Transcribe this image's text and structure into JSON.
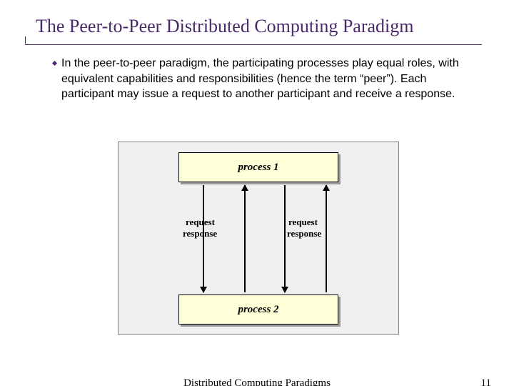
{
  "title": "The Peer-to-Peer Distributed Computing Paradigm",
  "body_text": "In the peer-to-peer paradigm, the participating processes play equal roles, with equivalent capabilities and responsibilities (hence the term “peer”).  Each participant may issue a request to another participant and receive a response.",
  "diagram": {
    "process1": "process 1",
    "process2": "process 2",
    "request": "request",
    "response": "response"
  },
  "footer": {
    "center": "Distributed Computing Paradigms",
    "page": "11"
  }
}
